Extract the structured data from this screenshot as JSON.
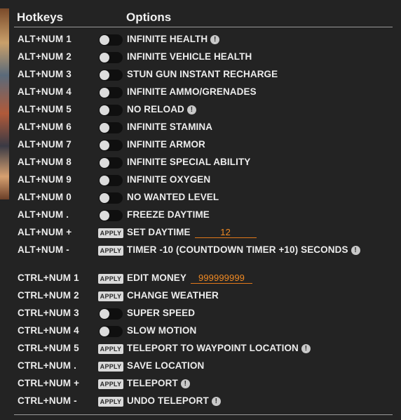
{
  "header": {
    "hotkeys": "Hotkeys",
    "options": "Options"
  },
  "colors": {
    "background": "#232323",
    "accent": "#f08a24",
    "toggle_off": "#0f0f0f",
    "apply_button": "#dadada"
  },
  "rows": [
    {
      "hotkey": "ALT+NUM 1",
      "control": "toggle",
      "state": "off",
      "label": "INFINITE HEALTH",
      "info": true
    },
    {
      "hotkey": "ALT+NUM 2",
      "control": "toggle",
      "state": "off",
      "label": "INFINITE VEHICLE HEALTH",
      "info": false
    },
    {
      "hotkey": "ALT+NUM 3",
      "control": "toggle",
      "state": "off",
      "label": "STUN GUN INSTANT RECHARGE",
      "info": false
    },
    {
      "hotkey": "ALT+NUM 4",
      "control": "toggle",
      "state": "off",
      "label": "INFINITE AMMO/GRENADES",
      "info": false
    },
    {
      "hotkey": "ALT+NUM 5",
      "control": "toggle",
      "state": "off",
      "label": "NO RELOAD",
      "info": true
    },
    {
      "hotkey": "ALT+NUM 6",
      "control": "toggle",
      "state": "off",
      "label": "INFINITE STAMINA",
      "info": false
    },
    {
      "hotkey": "ALT+NUM 7",
      "control": "toggle",
      "state": "off",
      "label": "INFINITE ARMOR",
      "info": false
    },
    {
      "hotkey": "ALT+NUM 8",
      "control": "toggle",
      "state": "off",
      "label": "INFINITE SPECIAL ABILITY",
      "info": false
    },
    {
      "hotkey": "ALT+NUM 9",
      "control": "toggle",
      "state": "off",
      "label": "INFINITE OXYGEN",
      "info": false
    },
    {
      "hotkey": "ALT+NUM 0",
      "control": "toggle",
      "state": "off",
      "label": "NO WANTED LEVEL",
      "info": false
    },
    {
      "hotkey": "ALT+NUM .",
      "control": "toggle",
      "state": "off",
      "label": "FREEZE DAYTIME",
      "info": false
    },
    {
      "hotkey": "ALT+NUM +",
      "control": "apply",
      "apply_label": "APPLY",
      "label": "SET DAYTIME",
      "value": "12",
      "info": false
    },
    {
      "hotkey": "ALT+NUM -",
      "control": "apply",
      "apply_label": "APPLY",
      "label": "TIMER -10 (COUNTDOWN TIMER +10) SECONDS",
      "info": true
    },
    {
      "hotkey": "CTRL+NUM 1",
      "control": "apply",
      "apply_label": "APPLY",
      "label": "EDIT MONEY",
      "value": "999999999",
      "info": false
    },
    {
      "hotkey": "CTRL+NUM 2",
      "control": "apply",
      "apply_label": "APPLY",
      "label": "CHANGE WEATHER",
      "info": false
    },
    {
      "hotkey": "CTRL+NUM 3",
      "control": "toggle",
      "state": "off",
      "label": "SUPER SPEED",
      "info": false
    },
    {
      "hotkey": "CTRL+NUM 4",
      "control": "toggle",
      "state": "off",
      "label": "SLOW MOTION",
      "info": false
    },
    {
      "hotkey": "CTRL+NUM 5",
      "control": "apply",
      "apply_label": "APPLY",
      "label": "TELEPORT TO WAYPOINT LOCATION",
      "info": true
    },
    {
      "hotkey": "CTRL+NUM .",
      "control": "apply",
      "apply_label": "APPLY",
      "label": "SAVE LOCATION",
      "info": false
    },
    {
      "hotkey": "CTRL+NUM +",
      "control": "apply",
      "apply_label": "APPLY",
      "label": "TELEPORT",
      "info": true
    },
    {
      "hotkey": "CTRL+NUM -",
      "control": "apply",
      "apply_label": "APPLY",
      "label": "UNDO TELEPORT",
      "info": true
    }
  ],
  "info_glyph": "!"
}
